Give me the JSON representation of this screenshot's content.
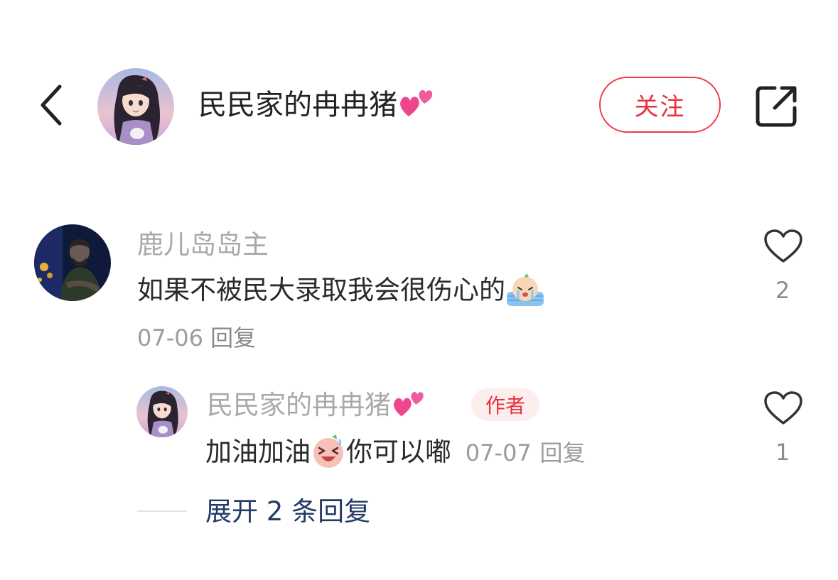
{
  "header": {
    "back_icon": "chevron-left-icon",
    "username": "民民家的冉冉猪",
    "name_emoji": "two-hearts-icon",
    "follow_label": "关注",
    "share_icon": "share-external-icon",
    "accent_color": "#e8303f"
  },
  "comment": {
    "username": "鹿儿岛岛主",
    "text": "如果不被民大录取我会很伤心的",
    "text_emoji": "crying-face-icon",
    "date": "07-06",
    "reply_label": "回复",
    "like_count": "2"
  },
  "reply": {
    "username": "民民家的冉冉猪",
    "name_emoji": "two-hearts-icon",
    "author_badge": "作者",
    "text_before": "加油加油",
    "text_emoji": "laughing-face-icon",
    "text_after": "你可以嘟",
    "date": "07-07",
    "reply_label": "回复",
    "like_count": "1"
  },
  "expand": {
    "label": "展开 2 条回复"
  }
}
